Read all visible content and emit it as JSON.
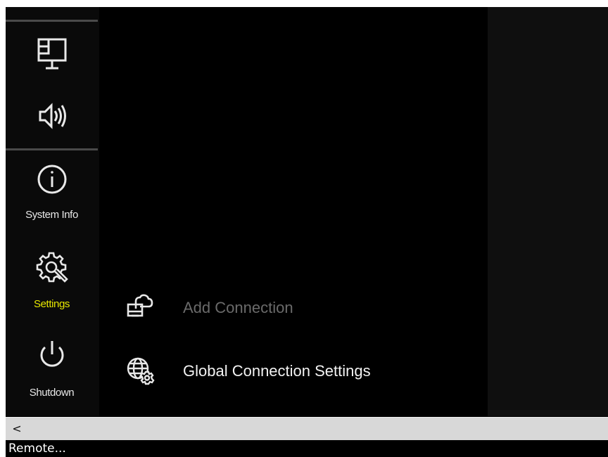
{
  "sidebar": {
    "items": [
      {
        "name": "display",
        "label": "",
        "icon": "monitor-icon"
      },
      {
        "name": "audio",
        "label": "",
        "icon": "speaker-icon"
      },
      {
        "name": "system-info",
        "label": "System Info",
        "icon": "info-icon"
      },
      {
        "name": "settings",
        "label": "Settings",
        "icon": "gear-wrench-icon",
        "active": true
      },
      {
        "name": "shutdown",
        "label": "Shutdown",
        "icon": "power-icon"
      }
    ]
  },
  "main": {
    "actions": [
      {
        "label": "Add Connection",
        "icon": "cloud-monitor-icon",
        "enabled": false
      },
      {
        "label": "Global Connection Settings",
        "icon": "globe-gear-icon",
        "enabled": true
      }
    ]
  },
  "scrollbar": {
    "left_arrow": "<"
  },
  "status": {
    "text": "Remote..."
  },
  "colors": {
    "background": "#000000",
    "sidebar_bg": "#0a0a0a",
    "active_label": "#e6e600",
    "disabled_text": "#6a6a6a",
    "text": "#f2f2f2"
  }
}
